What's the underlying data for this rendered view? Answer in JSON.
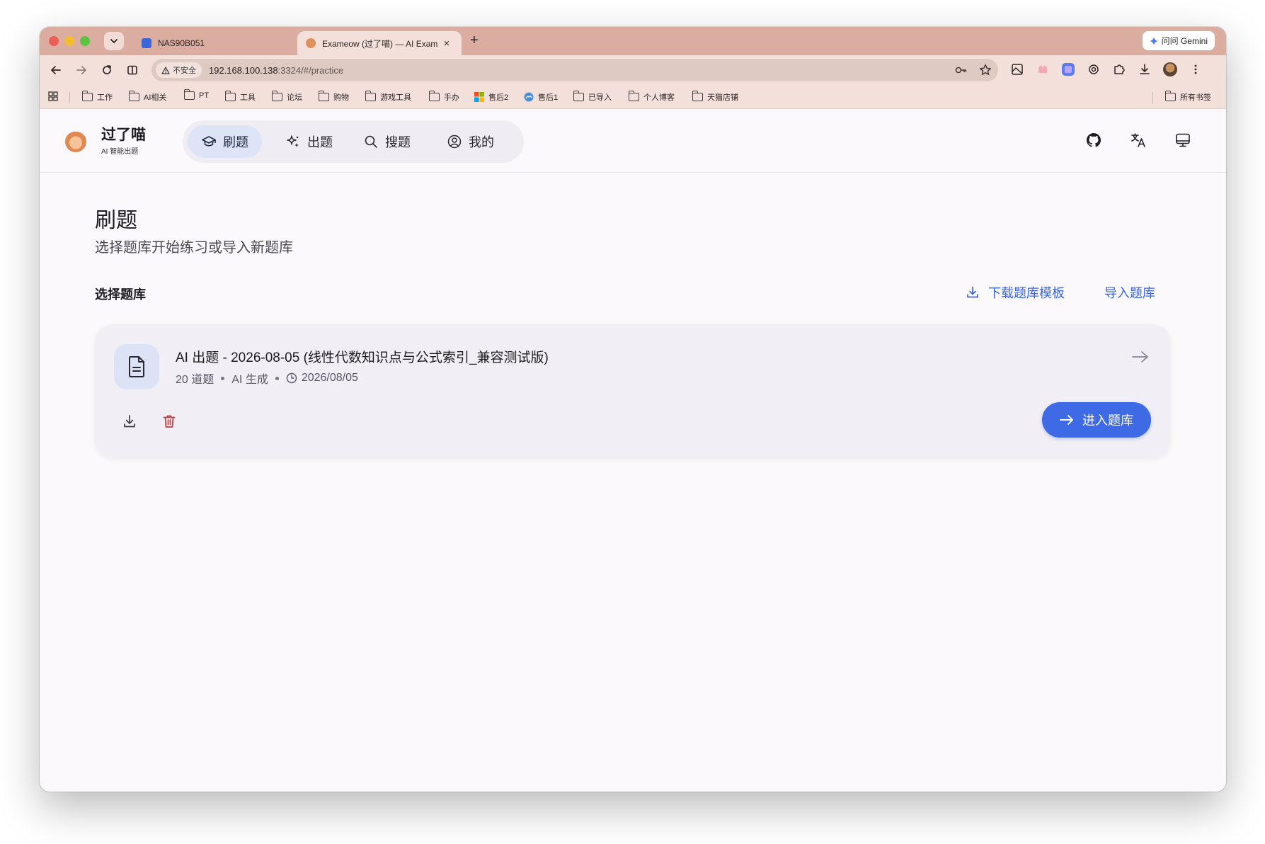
{
  "browser": {
    "tabs": [
      {
        "title": "NAS90B051",
        "active": false,
        "favicon_color": "#3a66d8"
      },
      {
        "title": "Exameow (过了喵) — AI Exam",
        "active": true,
        "favicon_color": "#e0905a"
      }
    ],
    "new_tab_label": "+",
    "gemini_label": "问问 Gemini",
    "insecure_label": "不安全",
    "url_host": "192.168.100.138",
    "url_rest": ":3324/#/practice",
    "bookmarks": [
      "工作",
      "AI相关",
      "PT",
      "工具",
      "论坛",
      "购物",
      "游戏工具",
      "手办",
      "售后2",
      "售后1",
      "已导入",
      "个人博客",
      "天猫店铺"
    ],
    "all_bookmarks_label": "所有书签",
    "frame_color": "#dbaca0"
  },
  "app": {
    "brand_name": "过了喵",
    "brand_sub": "AI 智能出题",
    "nav": [
      {
        "label": "刷题",
        "icon": "graduation-cap-icon",
        "active": true
      },
      {
        "label": "出题",
        "icon": "sparkles-icon",
        "active": false
      },
      {
        "label": "搜题",
        "icon": "search-icon",
        "active": false
      },
      {
        "label": "我的",
        "icon": "user-circle-icon",
        "active": false
      }
    ],
    "header_icons": [
      "github-icon",
      "translate-icon",
      "monitor-icon"
    ]
  },
  "main": {
    "title": "刷题",
    "subtitle": "选择题库开始练习或导入新题库",
    "section_title": "选择题库",
    "download_template_label": "下载题库模板",
    "import_label": "导入题库",
    "accent_color": "#3f6ae5"
  },
  "bank": {
    "title": "AI 出题 - 2026-08-05 (线性代数知识点与公式索引_兼容测试版)",
    "count": "20 道题",
    "source": "AI 生成",
    "date": "2026/08/05",
    "enter_label": "进入题库"
  }
}
